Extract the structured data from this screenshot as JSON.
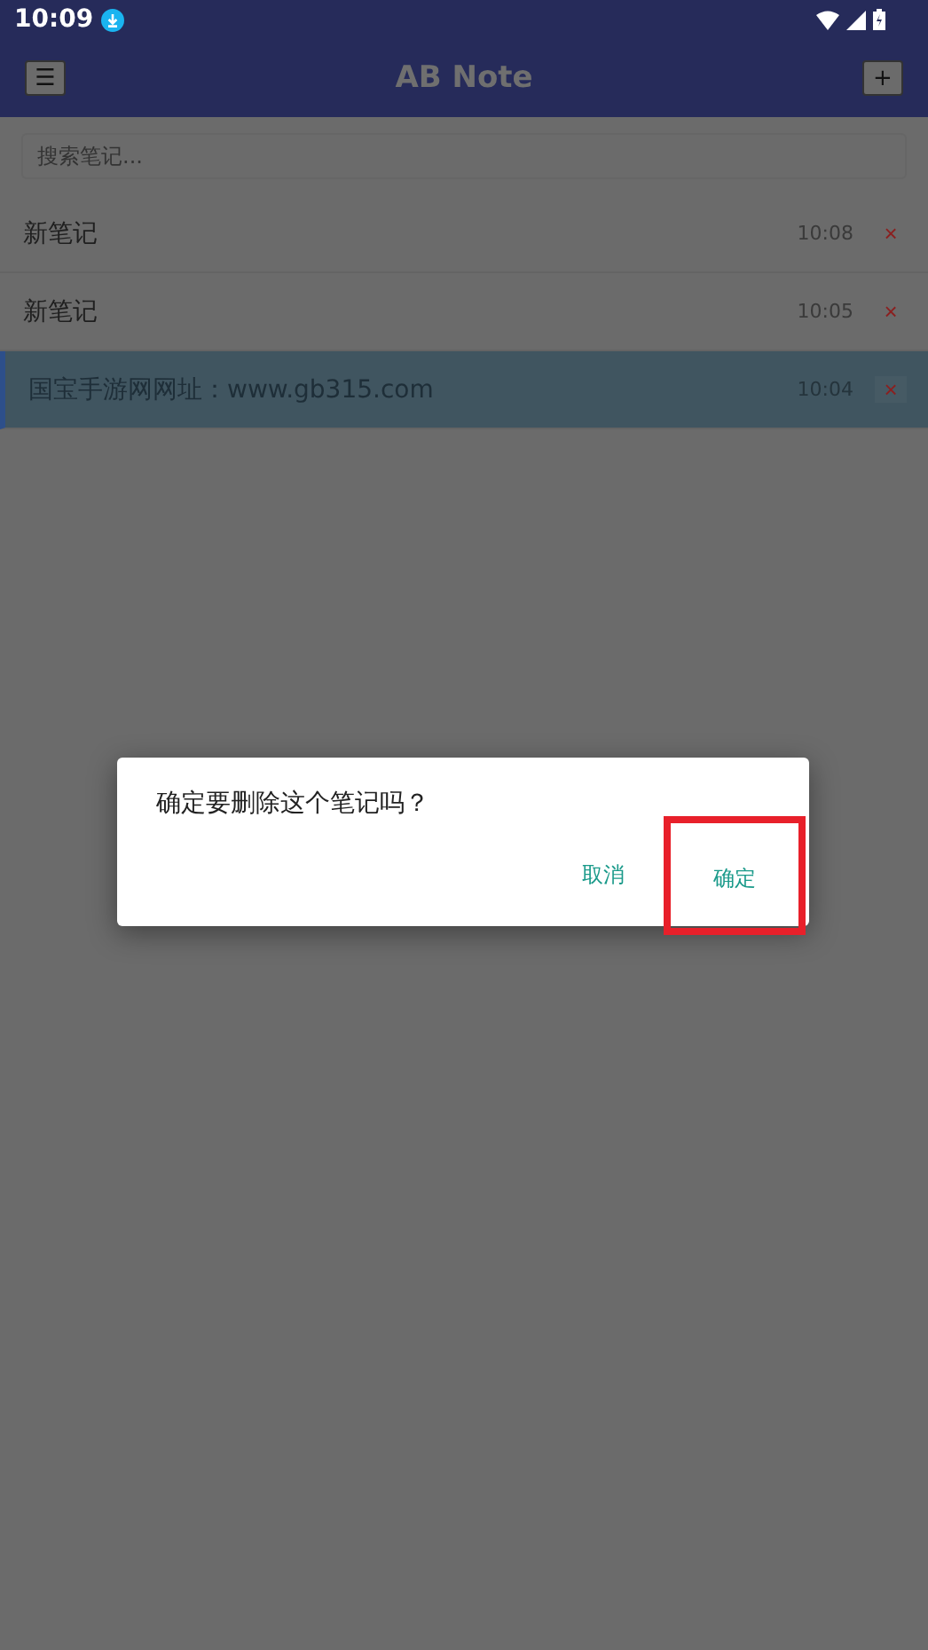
{
  "status_bar": {
    "time": "10:09"
  },
  "header": {
    "menu_button": "☰",
    "title": "AB Note",
    "add_button": "+"
  },
  "search": {
    "placeholder": "搜索笔记..."
  },
  "notes": [
    {
      "title": "新笔记",
      "time": "10:08",
      "delete": "×",
      "selected": false
    },
    {
      "title": "新笔记",
      "time": "10:05",
      "delete": "×",
      "selected": false
    },
    {
      "title": "国宝手游网网址：www.gb315.com",
      "time": "10:04",
      "delete": "×",
      "selected": true
    }
  ],
  "dialog": {
    "message": "确定要删除这个笔记吗？",
    "buttons": [
      {
        "label": "取消",
        "highlighted": false
      },
      {
        "label": "确定",
        "highlighted": true
      }
    ]
  }
}
